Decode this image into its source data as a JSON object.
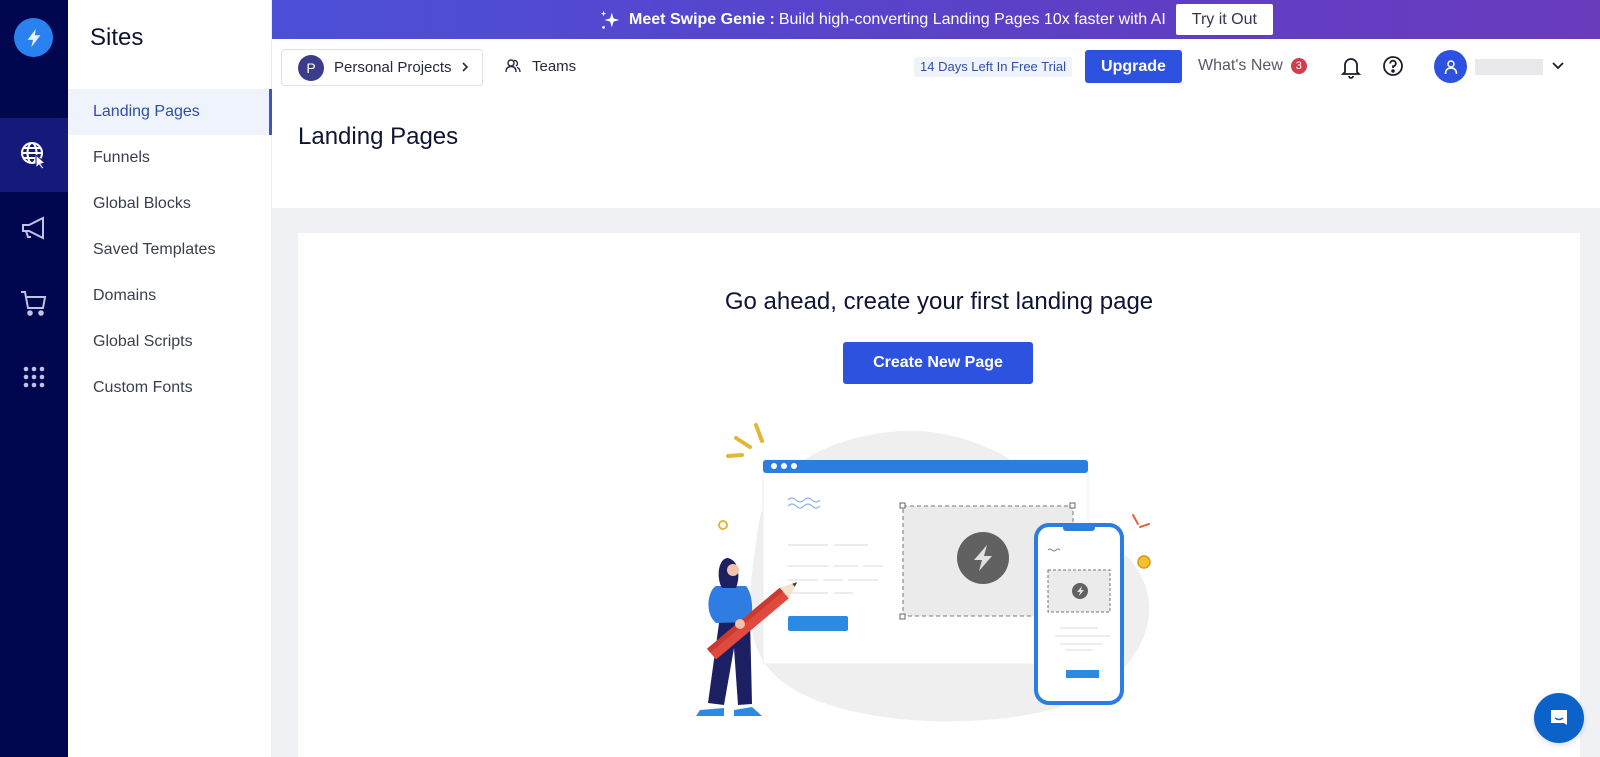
{
  "rail": {
    "items": [
      {
        "name": "sites",
        "icon": "globe-cursor-icon",
        "active": true
      },
      {
        "name": "marketing",
        "icon": "megaphone-icon",
        "active": false
      },
      {
        "name": "commerce",
        "icon": "cart-icon",
        "active": false
      },
      {
        "name": "apps",
        "icon": "grid-dots-icon",
        "active": false
      }
    ]
  },
  "sites": {
    "title": "Sites",
    "items": [
      {
        "label": "Landing Pages",
        "active": true
      },
      {
        "label": "Funnels"
      },
      {
        "label": "Global Blocks"
      },
      {
        "label": "Saved Templates"
      },
      {
        "label": "Domains"
      },
      {
        "label": "Global Scripts"
      },
      {
        "label": "Custom Fonts"
      }
    ]
  },
  "banner": {
    "highlight": "Meet Swipe Genie :",
    "text": "Build high-converting Landing Pages 10x faster with AI",
    "button": "Try it Out"
  },
  "topbar": {
    "project_initial": "P",
    "project_label": "Personal Projects",
    "teams_label": "Teams",
    "trial_label": "14 Days Left In Free Trial",
    "upgrade_label": "Upgrade",
    "whats_new_label": "What's New",
    "whats_new_count": "3"
  },
  "page": {
    "title": "Landing Pages",
    "empty_title": "Go ahead, create your first landing page",
    "create_button": "Create New Page"
  },
  "colors": {
    "rail": "#00074f",
    "accent": "#2e52e0",
    "banner": "#5b45cf"
  }
}
